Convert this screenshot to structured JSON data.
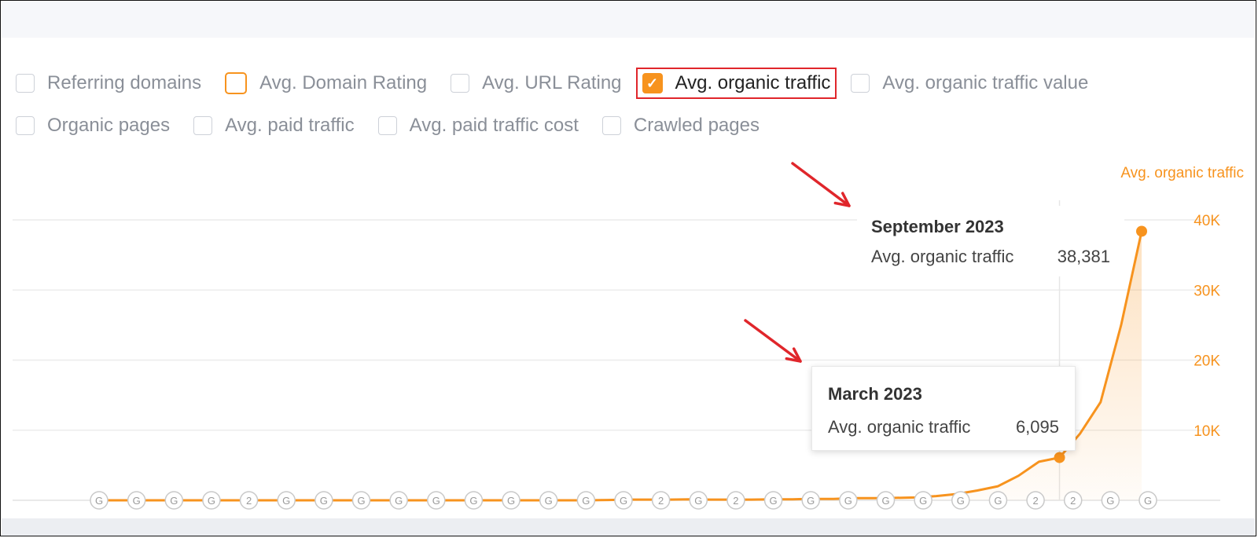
{
  "options": {
    "row1": [
      {
        "label": "Referring domains",
        "state": "unchecked"
      },
      {
        "label": "Avg. Domain Rating",
        "state": "orange-outline"
      },
      {
        "label": "Avg. URL Rating",
        "state": "unchecked"
      },
      {
        "label": "Avg. organic traffic",
        "state": "checked",
        "highlighted": true
      },
      {
        "label": "Avg. organic traffic value",
        "state": "unchecked"
      }
    ],
    "row2": [
      {
        "label": "Organic pages",
        "state": "unchecked"
      },
      {
        "label": "Avg. paid traffic",
        "state": "unchecked"
      },
      {
        "label": "Avg. paid traffic cost",
        "state": "unchecked"
      },
      {
        "label": "Crawled pages",
        "state": "unchecked"
      }
    ]
  },
  "tooltips": {
    "september": {
      "title": "September 2023",
      "metric": "Avg. organic traffic",
      "value": "38,381"
    },
    "march": {
      "title": "March 2023",
      "metric": "Avg. organic traffic",
      "value": "6,095"
    }
  },
  "colors": {
    "accent": "#f7931e",
    "highlight": "#e0262b",
    "grid": "#ececec"
  },
  "chart_data": {
    "type": "area",
    "ylabel": "Avg. organic traffic",
    "ylim": [
      0,
      40000
    ],
    "yticks": [
      {
        "value": 10000,
        "label": "10K"
      },
      {
        "value": 20000,
        "label": "20K"
      },
      {
        "value": 30000,
        "label": "30K"
      },
      {
        "value": 40000,
        "label": "40K"
      }
    ],
    "grid": true,
    "series": [
      {
        "name": "Avg. organic traffic",
        "color": "#f7931e",
        "values": [
          0,
          0,
          0,
          0,
          0,
          0,
          0,
          0,
          0,
          0,
          0,
          0,
          0,
          0,
          0,
          0,
          0,
          0,
          0,
          0,
          0,
          0,
          0,
          0,
          0,
          50,
          100,
          100,
          100,
          150,
          100,
          100,
          100,
          150,
          150,
          200,
          200,
          300,
          300,
          350,
          400,
          600,
          900,
          1400,
          2000,
          3500,
          5500,
          6095,
          9500,
          14000,
          25000,
          38381
        ]
      }
    ],
    "highlighted_points": [
      {
        "label": "March 2023",
        "value": 6095
      },
      {
        "label": "September 2023",
        "value": 38381
      }
    ],
    "annotation_marker_labels": [
      "G",
      "G",
      "G",
      "G",
      "2",
      "G",
      "G",
      "G",
      "G",
      "G",
      "G",
      "G",
      "G",
      "G",
      "G",
      "2",
      "G",
      "2",
      "G",
      "G",
      "G",
      "G",
      "G",
      "G",
      "G",
      "2",
      "2",
      "G",
      "G"
    ]
  }
}
